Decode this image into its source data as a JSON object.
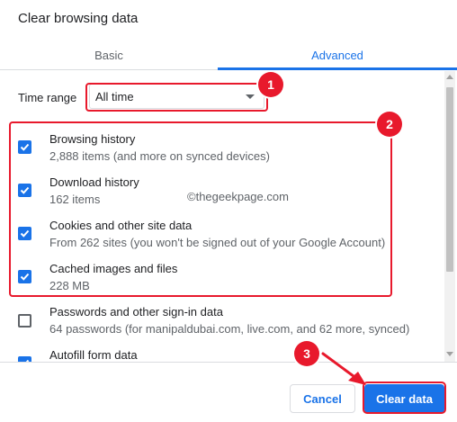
{
  "dialog": {
    "title": "Clear browsing data"
  },
  "tabs": [
    {
      "label": "Basic",
      "active": false
    },
    {
      "label": "Advanced",
      "active": true
    }
  ],
  "time_range": {
    "label": "Time range",
    "value": "All time"
  },
  "items": [
    {
      "title": "Browsing history",
      "subtitle": "2,888 items (and more on synced devices)",
      "checked": true
    },
    {
      "title": "Download history",
      "subtitle": "162 items",
      "checked": true
    },
    {
      "title": "Cookies and other site data",
      "subtitle": "From 262 sites (you won't be signed out of your Google Account)",
      "checked": true
    },
    {
      "title": "Cached images and files",
      "subtitle": "228 MB",
      "checked": true
    },
    {
      "title": "Passwords and other sign-in data",
      "subtitle": "64 passwords (for manipaldubai.com, live.com, and 62 more, synced)",
      "checked": false
    },
    {
      "title": "Autofill form data",
      "subtitle": "",
      "checked": true
    }
  ],
  "watermark": "©thegeekpage.com",
  "annotations": {
    "badge1": "1",
    "badge2": "2",
    "badge3": "3",
    "color": "#e8192c"
  },
  "footer": {
    "cancel_label": "Cancel",
    "clear_label": "Clear data"
  },
  "colors": {
    "accent": "#1a73e8",
    "text": "#202124",
    "secondary_text": "#5f6368"
  }
}
